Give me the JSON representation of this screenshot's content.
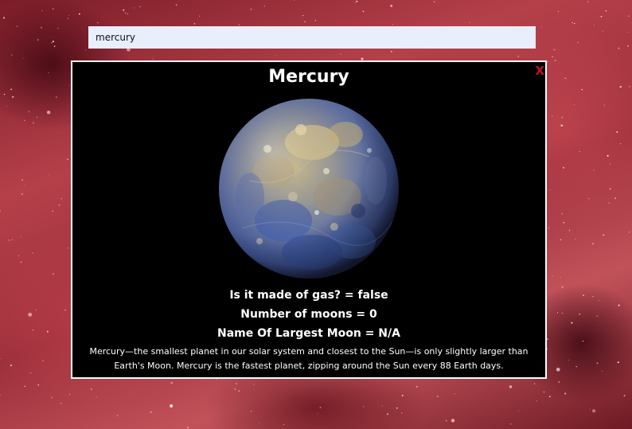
{
  "search": {
    "value": "mercury"
  },
  "planet_card": {
    "close_label": "X",
    "title": "Mercury",
    "facts": {
      "gas": "Is it made of gas? = false",
      "moons": "Number of moons = 0",
      "largest_moon": "Name Of Largest Moon = N/A"
    },
    "description": "Mercury—the smallest planet in our solar system and closest to the Sun—is only slightly larger than Earth's Moon. Mercury is the fastest planet, zipping around the Sun every 88 Earth days."
  },
  "colors": {
    "modal_background": "#000000",
    "modal_border": "#ffffff",
    "close_color": "#c0161e",
    "search_background": "#e8eefb"
  }
}
